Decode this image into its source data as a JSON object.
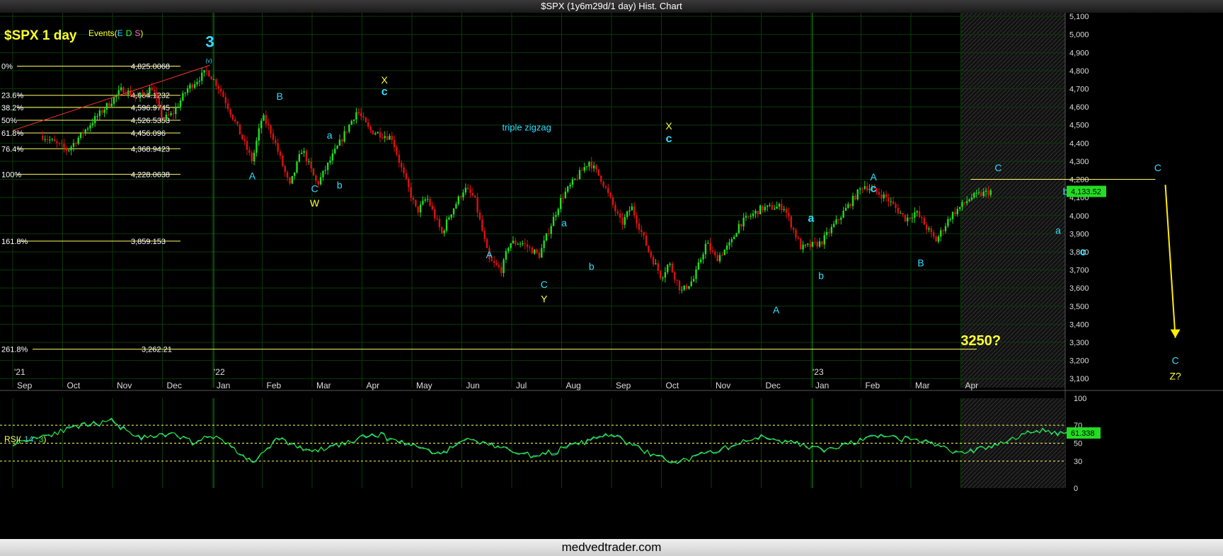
{
  "window": {
    "title": "$SPX (1y6m29d/1 day) Hist. Chart",
    "footer": "medvedtrader.com"
  },
  "header": {
    "symbol": "$SPX 1 day",
    "events_prefix": "Events(",
    "events_flags": [
      {
        "text": "E",
        "color": "#33ccff"
      },
      {
        "text": "D",
        "color": "#33ff33"
      },
      {
        "text": "S",
        "color": "#ff66cc"
      }
    ],
    "events_suffix": ")"
  },
  "colors": {
    "bull": "#22dd22",
    "bear": "#dd1111",
    "fib": "#ffff66",
    "wave_cyan": "#33ddff",
    "wave_yellow": "#ffff33",
    "rsi_line": "#33cccc",
    "rsi_signal": "#22ee22",
    "grid": "#0a3a0a",
    "year_line": "#1a8a1a"
  },
  "chart_data": [
    {
      "type": "candlestick",
      "title": "$SPX 1 day",
      "ylim": [
        3050,
        5120
      ],
      "y_ticks": [
        "5,100",
        "5,000",
        "4,900",
        "4,800",
        "4,700",
        "4,600",
        "4,500",
        "4,400",
        "4,300",
        "4,200",
        "4,100",
        "4,000",
        "3,900",
        "3,800",
        "3,700",
        "3,600",
        "3,500",
        "3,400",
        "3,300",
        "3,200",
        "3,100"
      ],
      "x_ticks": [
        "Sep",
        "Oct",
        "Nov",
        "Dec",
        "Jan",
        "Feb",
        "Mar",
        "Apr",
        "May",
        "Jun",
        "Jul",
        "Aug",
        "Sep",
        "Oct",
        "Nov",
        "Dec",
        "Jan",
        "Feb",
        "Mar",
        "Apr"
      ],
      "year_labels": [
        {
          "label": "'21",
          "month_index": 0
        },
        {
          "label": "'22",
          "month_index": 4
        },
        {
          "label": "'23",
          "month_index": 16
        }
      ],
      "last_price": "4,133.52",
      "anchors": [
        {
          "m": 0.6,
          "v": 4440
        },
        {
          "m": 1.1,
          "v": 4360
        },
        {
          "m": 1.6,
          "v": 4520
        },
        {
          "m": 2.2,
          "v": 4700
        },
        {
          "m": 2.5,
          "v": 4650
        },
        {
          "m": 2.8,
          "v": 4710
        },
        {
          "m": 3.0,
          "v": 4530
        },
        {
          "m": 3.2,
          "v": 4560
        },
        {
          "m": 3.5,
          "v": 4700
        },
        {
          "m": 3.9,
          "v": 4800
        },
        {
          "m": 4.15,
          "v": 4700
        },
        {
          "m": 4.4,
          "v": 4550
        },
        {
          "m": 4.8,
          "v": 4300
        },
        {
          "m": 5.0,
          "v": 4550
        },
        {
          "m": 5.2,
          "v": 4450
        },
        {
          "m": 5.55,
          "v": 4160
        },
        {
          "m": 5.8,
          "v": 4370
        },
        {
          "m": 6.1,
          "v": 4170
        },
        {
          "m": 6.9,
          "v": 4580
        },
        {
          "m": 7.15,
          "v": 4470
        },
        {
          "m": 7.6,
          "v": 4430
        },
        {
          "m": 7.8,
          "v": 4250
        },
        {
          "m": 8.1,
          "v": 4020
        },
        {
          "m": 8.3,
          "v": 4100
        },
        {
          "m": 8.6,
          "v": 3900
        },
        {
          "m": 8.75,
          "v": 4000
        },
        {
          "m": 9.05,
          "v": 4150
        },
        {
          "m": 9.25,
          "v": 4100
        },
        {
          "m": 9.55,
          "v": 3750
        },
        {
          "m": 9.8,
          "v": 3700
        },
        {
          "m": 9.95,
          "v": 3850
        },
        {
          "m": 10.2,
          "v": 3850
        },
        {
          "m": 10.55,
          "v": 3780
        },
        {
          "m": 11.0,
          "v": 4100
        },
        {
          "m": 11.55,
          "v": 4300
        },
        {
          "m": 11.8,
          "v": 4200
        },
        {
          "m": 12.2,
          "v": 3950
        },
        {
          "m": 12.4,
          "v": 4050
        },
        {
          "m": 12.75,
          "v": 3800
        },
        {
          "m": 13.0,
          "v": 3660
        },
        {
          "m": 13.15,
          "v": 3740
        },
        {
          "m": 13.4,
          "v": 3580
        },
        {
          "m": 13.65,
          "v": 3650
        },
        {
          "m": 13.9,
          "v": 3850
        },
        {
          "m": 14.1,
          "v": 3760
        },
        {
          "m": 14.4,
          "v": 3850
        },
        {
          "m": 14.55,
          "v": 3950
        },
        {
          "m": 15.0,
          "v": 4040
        },
        {
          "m": 15.45,
          "v": 4050
        },
        {
          "m": 15.8,
          "v": 3820
        },
        {
          "m": 16.2,
          "v": 3850
        },
        {
          "m": 16.6,
          "v": 4000
        },
        {
          "m": 17.05,
          "v": 4170
        },
        {
          "m": 17.5,
          "v": 4100
        },
        {
          "m": 17.9,
          "v": 3980
        },
        {
          "m": 18.1,
          "v": 4020
        },
        {
          "m": 18.5,
          "v": 3860
        },
        {
          "m": 18.8,
          "v": 4000
        },
        {
          "m": 19.2,
          "v": 4100
        },
        {
          "m": 19.6,
          "v": 4135
        }
      ],
      "fibonacci": [
        {
          "pct": "0%",
          "value": "4,825.0068",
          "level": 4825.0068
        },
        {
          "pct": "23.6%",
          "value": "4,664.1232",
          "level": 4664.1232
        },
        {
          "pct": "38.2%",
          "value": "4,596.9745",
          "level": 4596.9745
        },
        {
          "pct": "50%",
          "value": "4,526.5353",
          "level": 4526.5353
        },
        {
          "pct": "61.8%",
          "value": "4,456.096",
          "level": 4456.096
        },
        {
          "pct": "76.4%",
          "value": "4,368.9423",
          "level": 4368.9423
        },
        {
          "pct": "100%",
          "value": "4,228.0638",
          "level": 4228.0638
        },
        {
          "pct": "161.8%",
          "value": "3,859.153",
          "level": 3859.153
        },
        {
          "pct": "261.8%",
          "value": "3,262.21",
          "level": 3262.21
        }
      ],
      "wave_labels": [
        {
          "text": "3",
          "m": 3.95,
          "v": 4930,
          "color": "cyan",
          "size": 22
        },
        {
          "text": "(v)",
          "m": 3.93,
          "v": 4845,
          "color": "cyan",
          "size": 8
        },
        {
          "text": "A",
          "m": 4.8,
          "v": 4200,
          "color": "cyan",
          "size": 14
        },
        {
          "text": "B",
          "m": 5.35,
          "v": 4640,
          "color": "cyan",
          "size": 14
        },
        {
          "text": "C",
          "m": 6.05,
          "v": 4130,
          "color": "cyan",
          "size": 14
        },
        {
          "text": "W",
          "m": 6.05,
          "v": 4050,
          "color": "yellow",
          "size": 14
        },
        {
          "text": "a",
          "m": 6.35,
          "v": 4425,
          "color": "cyan",
          "size": 14
        },
        {
          "text": "b",
          "m": 6.55,
          "v": 4150,
          "color": "cyan",
          "size": 14
        },
        {
          "text": "X",
          "m": 7.45,
          "v": 4730,
          "color": "yellow",
          "size": 14
        },
        {
          "text": "c",
          "m": 7.45,
          "v": 4665,
          "color": "cyan",
          "size": 16
        },
        {
          "text": "triple zigzag",
          "m": 10.3,
          "v": 4470,
          "color": "cyan",
          "size": 13
        },
        {
          "text": "A",
          "m": 9.55,
          "v": 3765,
          "color": "cyan",
          "size": 14
        },
        {
          "text": "C",
          "m": 10.65,
          "v": 3600,
          "color": "cyan",
          "size": 14
        },
        {
          "text": "Y",
          "m": 10.65,
          "v": 3520,
          "color": "yellow",
          "size": 14
        },
        {
          "text": "a",
          "m": 11.05,
          "v": 3940,
          "color": "cyan",
          "size": 14
        },
        {
          "text": "b",
          "m": 11.6,
          "v": 3700,
          "color": "cyan",
          "size": 14
        },
        {
          "text": "X",
          "m": 13.15,
          "v": 4475,
          "color": "yellow",
          "size": 14
        },
        {
          "text": "c",
          "m": 13.15,
          "v": 4405,
          "color": "cyan",
          "size": 16
        },
        {
          "text": "A",
          "m": 15.3,
          "v": 3460,
          "color": "cyan",
          "size": 14
        },
        {
          "text": "a",
          "m": 16.0,
          "v": 3965,
          "color": "cyan",
          "size": 16
        },
        {
          "text": "b",
          "m": 16.2,
          "v": 3650,
          "color": "cyan",
          "size": 14
        },
        {
          "text": "A",
          "m": 17.25,
          "v": 4195,
          "color": "cyan",
          "size": 14
        },
        {
          "text": "c",
          "m": 17.25,
          "v": 4130,
          "color": "cyan",
          "size": 16
        },
        {
          "text": "B",
          "m": 18.2,
          "v": 3720,
          "color": "cyan",
          "size": 14
        },
        {
          "text": "C",
          "m": 19.75,
          "v": 4245,
          "color": "cyan",
          "size": 14
        },
        {
          "text": "b",
          "m": 21.1,
          "v": 4115,
          "color": "cyan",
          "size": 14
        },
        {
          "text": "a",
          "m": 20.95,
          "v": 3900,
          "color": "cyan",
          "size": 14
        },
        {
          "text": "c",
          "m": 21.45,
          "v": 3780,
          "color": "cyan",
          "size": 16
        },
        {
          "text": "C",
          "m": 22.95,
          "v": 4245,
          "color": "cyan",
          "size": 14
        },
        {
          "text": "3250?",
          "m": 19.4,
          "v": 3285,
          "color": "yellow",
          "size": 20
        },
        {
          "text": "C",
          "m": 23.3,
          "v": 3180,
          "color": "cyan",
          "size": 14
        },
        {
          "text": "Z?",
          "m": 23.3,
          "v": 3095,
          "color": "yellow",
          "size": 14
        }
      ],
      "annotations": {
        "channel_line": {
          "from": {
            "m": 0.0,
            "v": 4470
          },
          "to": {
            "m": 3.95,
            "v": 4830
          }
        },
        "resistance_line": {
          "from": {
            "m": 19.2,
            "v": 4200
          },
          "to": {
            "m": 22.9,
            "v": 4200
          }
        },
        "projection_arrow": {
          "from": {
            "m": 23.1,
            "v": 4170
          },
          "to": {
            "m": 23.3,
            "v": 3325
          }
        }
      }
    },
    {
      "type": "line",
      "title": "RSI( 14, 3 )",
      "title_prefix": "RSI(",
      "title_params": [
        {
          "text": "14,",
          "color": "#33cccc"
        },
        {
          "text": "3",
          "color": "#22ee22"
        }
      ],
      "title_suffix": ")",
      "ylim": [
        0,
        100
      ],
      "y_ticks": [
        "100",
        "70",
        "50",
        "30",
        "0"
      ],
      "reference_levels": [
        70,
        50,
        30
      ],
      "last_value": "61.338",
      "anchors": [
        {
          "m": 0.0,
          "v": 50
        },
        {
          "m": 1.3,
          "v": 68
        },
        {
          "m": 2.0,
          "v": 74
        },
        {
          "m": 2.6,
          "v": 55
        },
        {
          "m": 3.2,
          "v": 60
        },
        {
          "m": 3.6,
          "v": 52
        },
        {
          "m": 4.1,
          "v": 58
        },
        {
          "m": 4.8,
          "v": 28
        },
        {
          "m": 5.3,
          "v": 55
        },
        {
          "m": 6.0,
          "v": 40
        },
        {
          "m": 7.3,
          "v": 60
        },
        {
          "m": 8.6,
          "v": 38
        },
        {
          "m": 9.1,
          "v": 55
        },
        {
          "m": 10.5,
          "v": 35
        },
        {
          "m": 11.5,
          "v": 52
        },
        {
          "m": 12.0,
          "v": 60
        },
        {
          "m": 12.7,
          "v": 40
        },
        {
          "m": 13.3,
          "v": 28
        },
        {
          "m": 14.3,
          "v": 45
        },
        {
          "m": 15.0,
          "v": 58
        },
        {
          "m": 16.3,
          "v": 42
        },
        {
          "m": 17.3,
          "v": 58
        },
        {
          "m": 18.3,
          "v": 52
        },
        {
          "m": 19.0,
          "v": 38
        },
        {
          "m": 19.6,
          "v": 47
        },
        {
          "m": 20.5,
          "v": 64
        },
        {
          "m": 21.2,
          "v": 61
        }
      ]
    }
  ]
}
